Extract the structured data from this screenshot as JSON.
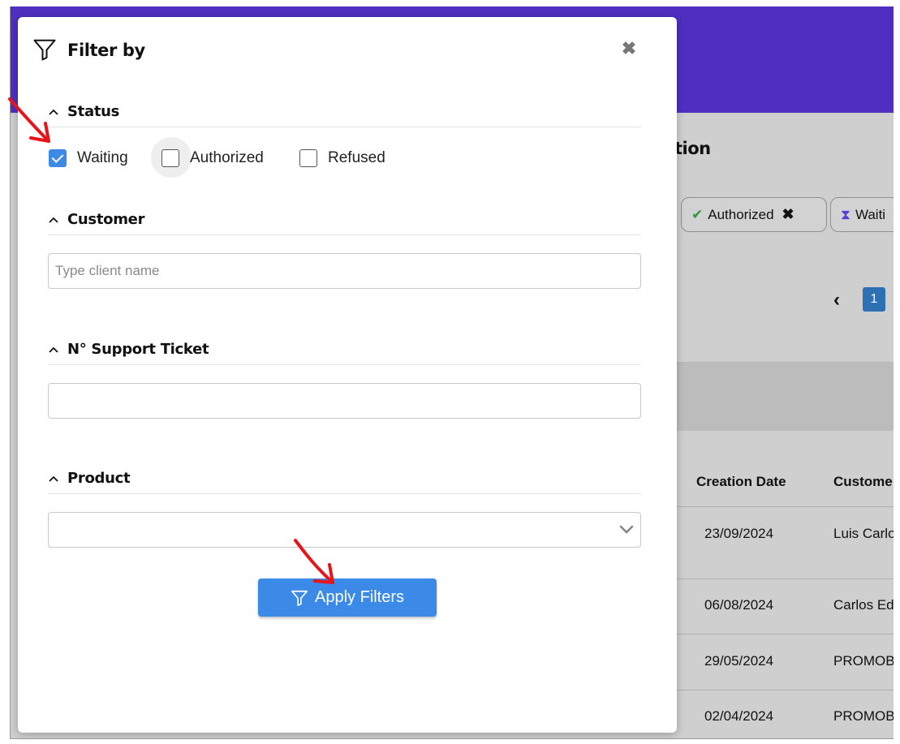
{
  "background": {
    "page_title_fragment": "tion",
    "chips": [
      {
        "label": "Authorized",
        "icon": "check-icon"
      },
      {
        "label": "Waiti",
        "icon": "hourglass-icon"
      }
    ],
    "pager": {
      "prev_icon": "chevron-left-icon",
      "current_page": "1"
    },
    "table": {
      "headers": [
        "Creation Date",
        "Custome"
      ],
      "rows": [
        {
          "date": "23/09/2024",
          "customer": "Luis Carlo"
        },
        {
          "date": "06/08/2024",
          "customer": "Carlos Ed"
        },
        {
          "date": "29/05/2024",
          "customer": "PROMOB"
        },
        {
          "date": "02/04/2024",
          "customer": "PROMOB"
        }
      ]
    }
  },
  "modal": {
    "title": "Filter by",
    "close_icon": "close-icon",
    "sections": {
      "status": {
        "label": "Status",
        "options": [
          {
            "label": "Waiting",
            "checked": true
          },
          {
            "label": "Authorized",
            "checked": false
          },
          {
            "label": "Refused",
            "checked": false
          }
        ]
      },
      "customer": {
        "label": "Customer",
        "placeholder": "Type client name",
        "value": ""
      },
      "ticket": {
        "label": "N° Support Ticket",
        "value": ""
      },
      "product": {
        "label": "Product",
        "selected": ""
      }
    },
    "apply_label": "Apply Filters"
  },
  "colors": {
    "header": "#4f2fbf",
    "primary": "#3b8ae8",
    "annotation": "#e8141c"
  }
}
